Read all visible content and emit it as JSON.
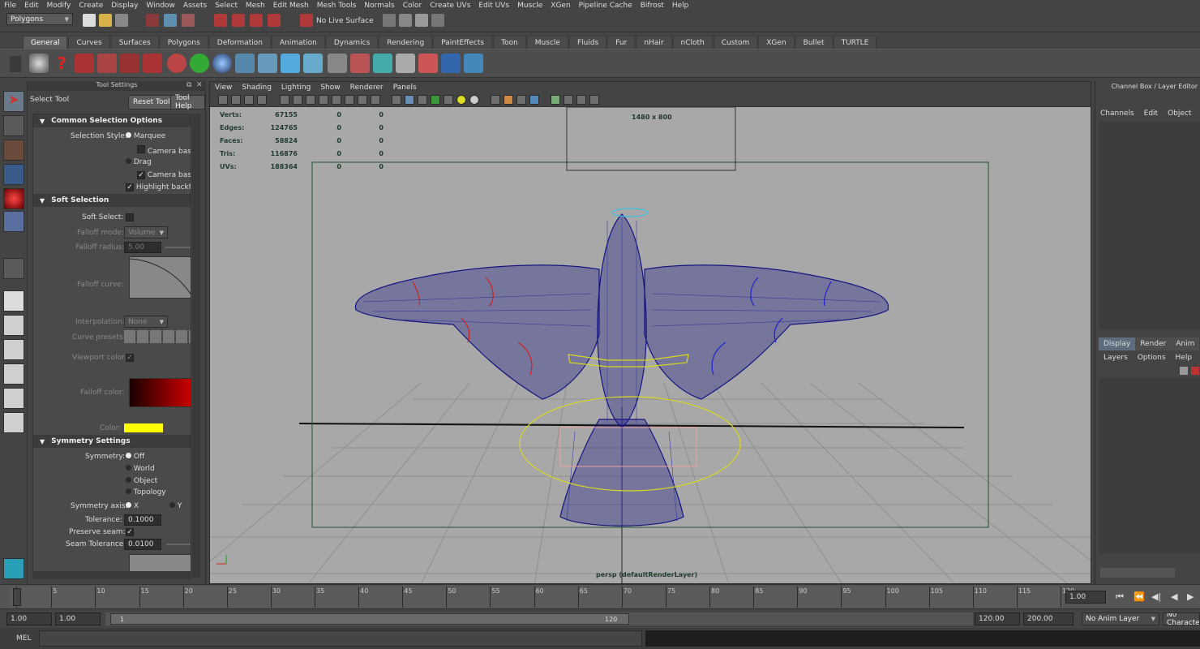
{
  "menubar": [
    "File",
    "Edit",
    "Modify",
    "Create",
    "Display",
    "Window",
    "Assets",
    "Select",
    "Mesh",
    "Edit Mesh",
    "Mesh Tools",
    "Normals",
    "Color",
    "Create UVs",
    "Edit UVs",
    "Muscle",
    "XGen",
    "Pipeline Cache",
    "Bifrost",
    "Help"
  ],
  "statusline": {
    "mode": "Polygons",
    "live_surface": "No Live Surface"
  },
  "shelf_tabs": [
    "General",
    "Curves",
    "Surfaces",
    "Polygons",
    "Deformation",
    "Animation",
    "Dynamics",
    "Rendering",
    "PaintEffects",
    "Toon",
    "Muscle",
    "Fluids",
    "Fur",
    "nHair",
    "nCloth",
    "Custom",
    "XGen",
    "Bullet",
    "TURTLE"
  ],
  "tool_settings": {
    "panel_title": "Tool Settings",
    "tool_name": "Select Tool",
    "reset_button": "Reset Tool",
    "help_button": "Tool Help",
    "common_header": "Common Selection Options",
    "selection_style_label": "Selection Style:",
    "marquee": "Marquee",
    "camera_based_1": "Camera based",
    "drag": "Drag",
    "camera_based_2": "Camera based",
    "highlight_backfaces": "Highlight backfaces",
    "soft_header": "Soft Selection",
    "soft_select_label": "Soft Select:",
    "falloff_mode_label": "Falloff mode:",
    "falloff_mode_value": "Volume",
    "falloff_radius_label": "Falloff radius:",
    "falloff_radius_value": "5.00",
    "falloff_curve_label": "Falloff curve:",
    "interpolation_label": "Interpolation:",
    "interpolation_value": "None",
    "curve_presets_label": "Curve presets:",
    "viewport_color_label": "Viewport color:",
    "falloff_color_label": "Falloff color:",
    "color_label": "Color:",
    "symmetry_header": "Symmetry Settings",
    "symmetry_label": "Symmetry:",
    "sym_off": "Off",
    "sym_world": "World",
    "sym_object": "Object",
    "sym_topology": "Topology",
    "symmetry_axis_label": "Symmetry axis:",
    "axis_x": "X",
    "axis_y": "Y",
    "tolerance_label": "Tolerance:",
    "tolerance_value": "0.1000",
    "preserve_seam_label": "Preserve seam:",
    "seam_tolerance_label": "Seam Tolerance:",
    "seam_tolerance_value": "0.0100"
  },
  "viewport": {
    "menus": [
      "View",
      "Shading",
      "Lighting",
      "Show",
      "Renderer",
      "Panels"
    ],
    "resolution": "1480 x 800",
    "camera_label": "persp (defaultRenderLayer)",
    "hud": [
      {
        "label": "Verts:",
        "v1": "67155",
        "v2": "0",
        "v3": "0"
      },
      {
        "label": "Edges:",
        "v1": "124765",
        "v2": "0",
        "v3": "0"
      },
      {
        "label": "Faces:",
        "v1": "58824",
        "v2": "0",
        "v3": "0"
      },
      {
        "label": "Tris:",
        "v1": "116876",
        "v2": "0",
        "v3": "0"
      },
      {
        "label": "UVs:",
        "v1": "188364",
        "v2": "0",
        "v3": "0"
      }
    ]
  },
  "channel_box": {
    "title": "Channel Box / Layer Editor",
    "menus": [
      "Channels",
      "Edit",
      "Object",
      "Sh"
    ],
    "layer_tabs": [
      "Display",
      "Render",
      "Anim"
    ],
    "layer_menus": [
      "Layers",
      "Options",
      "Help"
    ]
  },
  "timeline": {
    "ticks": [
      "1",
      "5",
      "10",
      "15",
      "20",
      "25",
      "30",
      "35",
      "40",
      "45",
      "50",
      "55",
      "60",
      "65",
      "70",
      "75",
      "80",
      "85",
      "90",
      "95",
      "100",
      "105",
      "110",
      "115",
      "120"
    ],
    "current_frame": "1.00"
  },
  "range": {
    "start": "1.00",
    "start2": "1.00",
    "slider_start": "1",
    "slider_end": "120",
    "end": "120.00",
    "end2": "200.00",
    "anim_layer": "No Anim Layer",
    "character": "No Characte"
  },
  "cmdline": {
    "label": "MEL"
  },
  "colors": {
    "falloff_color_end": "#cc0000",
    "color_swatch": "#ffff00",
    "wire": "#141480"
  }
}
